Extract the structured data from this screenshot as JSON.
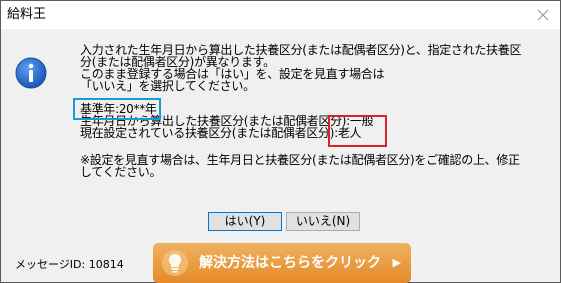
{
  "window": {
    "title": "給料王"
  },
  "message": {
    "line1": "入力された生年月日から算出した扶養区分(または配偶者区分)と、指定された扶養区",
    "line2": "分(または配偶者区分)が異なります。",
    "line3": "このまま登録する場合は「はい」を、設定を見直す場合は",
    "line4": "「いいえ」を選択してください。",
    "base_year": "基準年:20**年",
    "calc_label": "生年月日から算出した扶養区分(または配偶者区分):",
    "calc_value": "一般",
    "current_label": "現在設定されている扶養区分(または配偶者区分):",
    "current_value": "老人",
    "note_line1": "※設定を見直す場合は、生年月日と扶養区分(または配偶者区分)をご確認の上、修正",
    "note_line2": "してください。"
  },
  "buttons": {
    "yes": "はい(Y)",
    "no": "いいえ(N)"
  },
  "footer": {
    "message_id": "メッセージID: 10814",
    "help_button": "解決方法はこちらをクリック",
    "help_arrow": "▶"
  },
  "colors": {
    "highlight_blue": "#1a9ad6",
    "highlight_red": "#d9232a",
    "help_button": "#e8952f"
  },
  "icons": {
    "dialog_icon": "info-icon",
    "help_icon": "lightbulb-icon",
    "close_icon": "close-icon"
  }
}
